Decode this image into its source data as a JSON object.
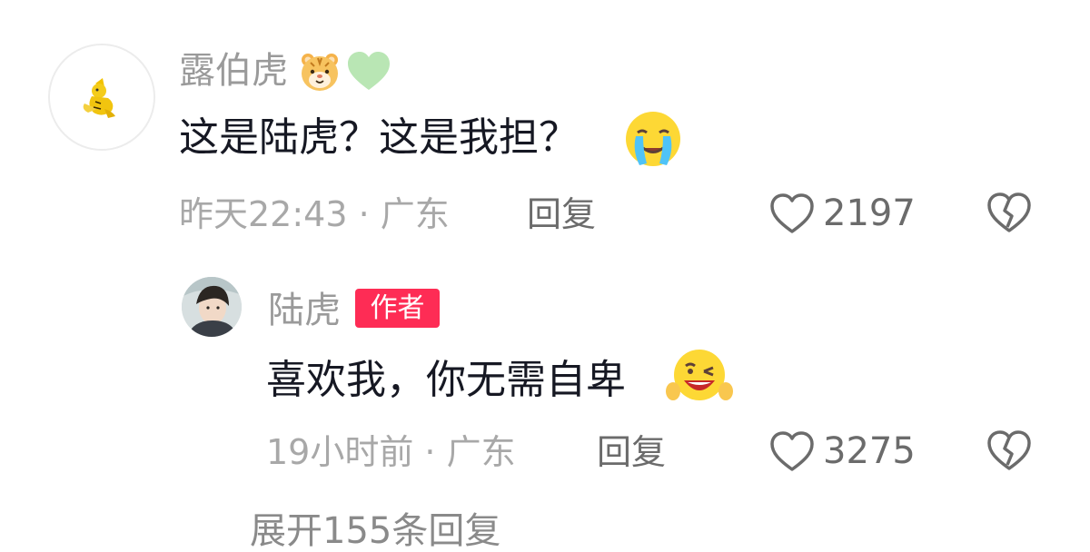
{
  "comment": {
    "username": "露伯虎",
    "username_emojis": [
      "tiger-face-icon",
      "green-heart-icon"
    ],
    "text": "这是陆虎？这是我担？",
    "text_emoji": "crying-face-icon",
    "meta": "昨天22:43 · 广东",
    "reply_label": "回复",
    "like_count": "2197"
  },
  "reply": {
    "username": "陆虎",
    "badge": "作者",
    "text": "喜欢我，你无需自卑",
    "text_emoji": "winking-face-icon",
    "meta": "19小时前 · 广东",
    "reply_label": "回复",
    "like_count": "3275"
  },
  "expand_replies": "展开155条回复",
  "colors": {
    "badge": "#fe2c55",
    "text": "#161823",
    "meta": "#a8a8a8",
    "username": "#9a9a9a"
  }
}
